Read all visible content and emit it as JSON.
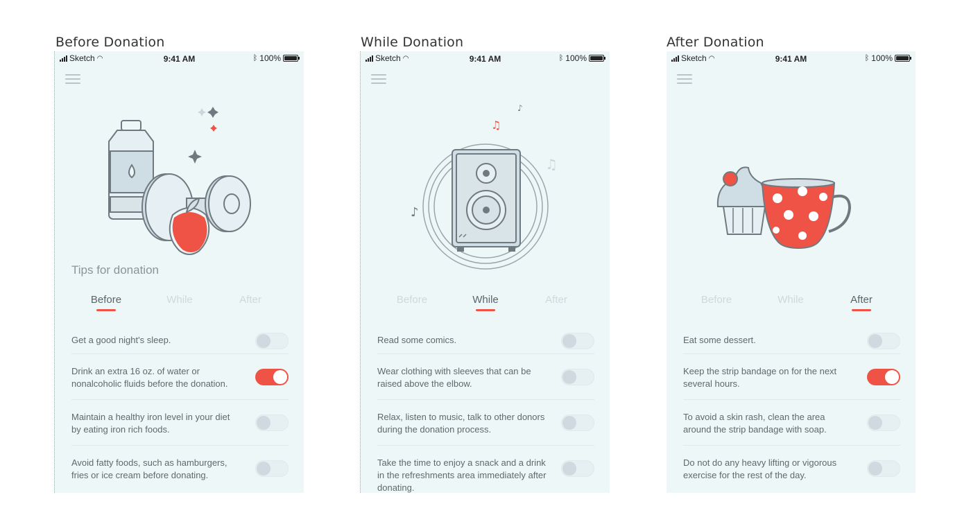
{
  "screens": [
    {
      "title": "Before Donation",
      "status": {
        "carrier": "Sketch",
        "time": "9:41 AM",
        "battery": "100%"
      },
      "tips_title": "Tips for donation",
      "tabs": [
        "Before",
        "While",
        "After"
      ],
      "active_tab": 0,
      "items": [
        {
          "text": "Get a good night's sleep.",
          "on": false
        },
        {
          "text": "Drink an extra 16 oz. of water or nonalcoholic fluids before the donation.",
          "on": true
        },
        {
          "text": "Maintain a healthy iron level in your diet by eating iron rich foods.",
          "on": false
        },
        {
          "text": "Avoid fatty foods, such as hamburgers, fries or ice cream before donating.",
          "on": false
        }
      ]
    },
    {
      "title": "While Donation",
      "status": {
        "carrier": "Sketch",
        "time": "9:41 AM",
        "battery": "100%"
      },
      "tips_title": "",
      "tabs": [
        "Before",
        "While",
        "After"
      ],
      "active_tab": 1,
      "items": [
        {
          "text": "Read some comics.",
          "on": false
        },
        {
          "text": "Wear clothing with sleeves that can be raised above the elbow.",
          "on": false
        },
        {
          "text": "Relax, listen to music, talk to other donors during the donation process.",
          "on": false
        },
        {
          "text": "Take the time to enjoy a snack and a drink in the refreshments area immediately after donating.",
          "on": false
        }
      ]
    },
    {
      "title": "After Donation",
      "status": {
        "carrier": "Sketch",
        "time": "9:41 AM",
        "battery": "100%"
      },
      "tips_title": "",
      "tabs": [
        "Before",
        "While",
        "After"
      ],
      "active_tab": 2,
      "items": [
        {
          "text": "Eat some dessert.",
          "on": false
        },
        {
          "text": "Keep the strip bandage on for the next several hours.",
          "on": true
        },
        {
          "text": "To avoid a skin rash, clean the area around the strip bandage with soap.",
          "on": false
        },
        {
          "text": "Do not do any heavy lifting or vigorous exercise for the rest of the day.",
          "on": false
        }
      ]
    }
  ],
  "icons": {
    "screen_0": [
      "water-bottle-icon",
      "dumbbell-icon",
      "apple-icon",
      "sparkle-icon"
    ],
    "screen_1": [
      "speaker-icon",
      "music-note-icon"
    ],
    "screen_2": [
      "cupcake-icon",
      "polka-dot-cup-icon"
    ]
  },
  "colors": {
    "accent": "#ef5346",
    "background": "#eef7f7",
    "illustration_stroke": "#6f7a80",
    "illustration_fill": "#d6e2e8"
  }
}
